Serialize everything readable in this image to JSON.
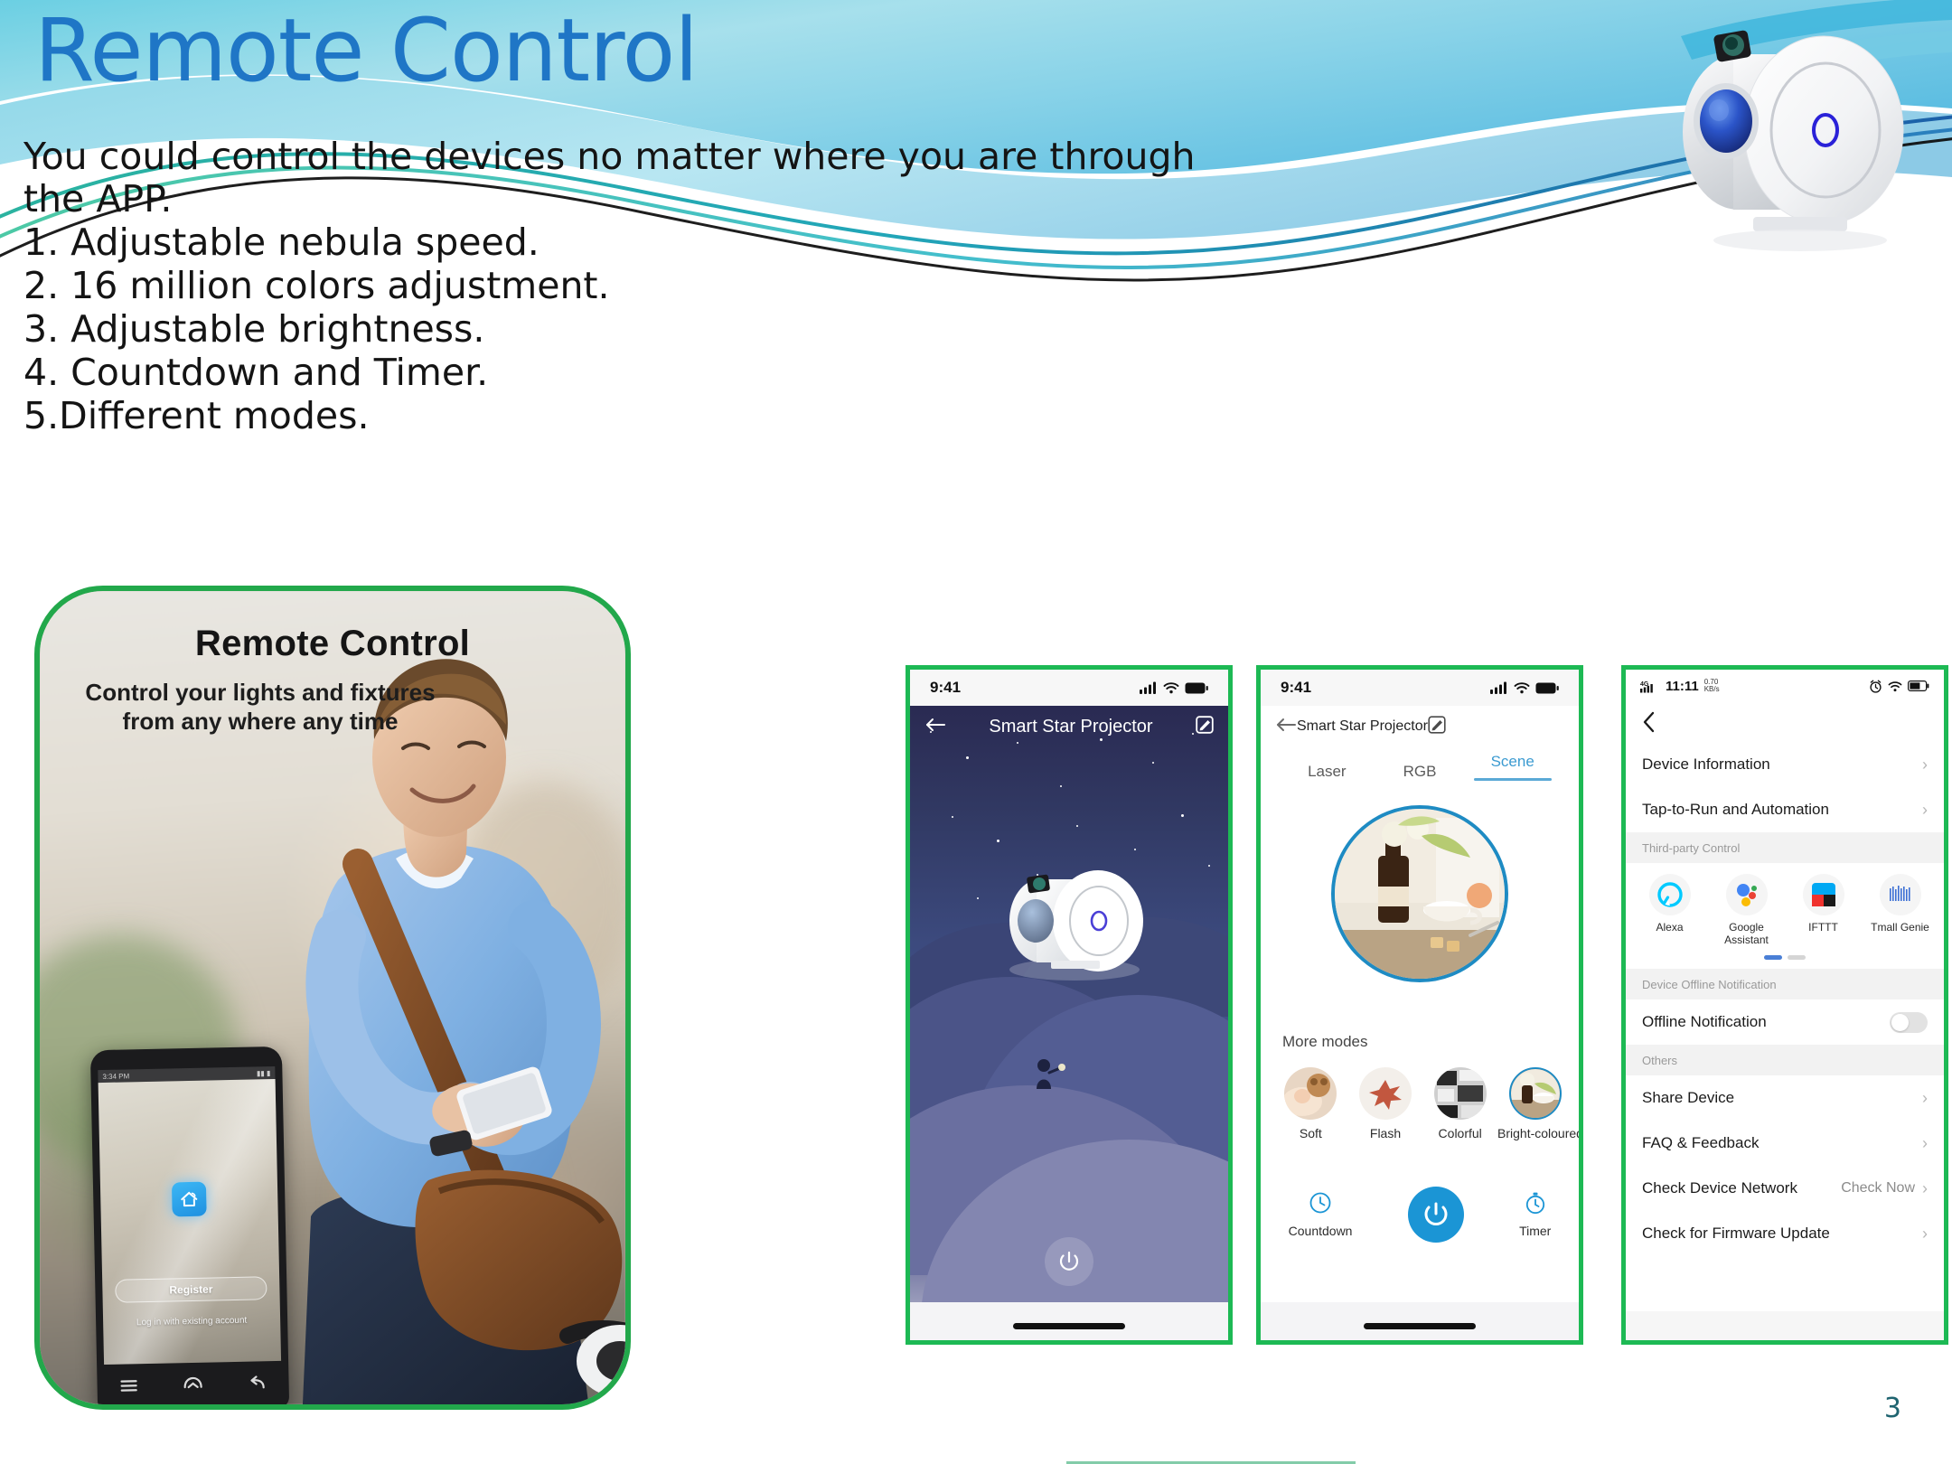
{
  "slide": {
    "title": "Remote Control",
    "page_number": "3",
    "body_lines": [
      "You could control the devices no matter where you are through",
      "the APP.",
      "1. Adjustable nebula speed.",
      "2. 16 million colors adjustment.",
      "3. Adjustable brightness.",
      "4. Countdown and Timer.",
      "5.Different modes."
    ],
    "colors": {
      "title_blue": "#1F76C6",
      "accent_teal": "#29B5C8",
      "card_green": "#22A84B",
      "app_blue": "#1B95D5",
      "page_num": "#1F6470"
    }
  },
  "photo_card": {
    "headline": "Remote Control",
    "subhead": "Control your lights and fixtures from any where any time",
    "inner_phone": {
      "status_time": "3:34 PM",
      "app_icon": "smart-home-icon",
      "register_label": "Register",
      "login_label": "Log in with existing account",
      "nav_icons": [
        "menu-icon",
        "home-icon",
        "back-icon"
      ]
    }
  },
  "phone1": {
    "status": {
      "time": "9:41",
      "icons": [
        "cellular-icon",
        "wifi-icon",
        "battery-icon"
      ]
    },
    "navbar": {
      "back": "back-arrow-icon",
      "title": "Smart Star Projector",
      "edit": "edit-icon"
    },
    "power_button": "power-icon"
  },
  "phone2": {
    "status": {
      "time": "9:41",
      "icons": [
        "cellular-icon",
        "wifi-icon",
        "battery-icon"
      ]
    },
    "navbar": {
      "back": "back-arrow-icon",
      "title": "Smart Star Projector",
      "edit": "edit-icon"
    },
    "tabs": [
      {
        "label": "Laser",
        "active": false
      },
      {
        "label": "RGB",
        "active": false
      },
      {
        "label": "Scene",
        "active": true
      }
    ],
    "more_modes_label": "More modes",
    "modes": [
      {
        "label": "Soft",
        "selected": false
      },
      {
        "label": "Flash",
        "selected": false
      },
      {
        "label": "Colorful",
        "selected": false
      },
      {
        "label": "Bright-coloured",
        "selected": true
      }
    ],
    "controls": {
      "countdown_label": "Countdown",
      "timer_label": "Timer",
      "power_label": "power-icon"
    }
  },
  "phone3": {
    "status": {
      "network": "4G",
      "time": "11:11",
      "speed_value": "0.70",
      "speed_unit": "KB/s",
      "icons": [
        "alarm-icon",
        "wifi-icon",
        "battery-icon"
      ]
    },
    "back": "chevron-left-icon",
    "rows_top": [
      {
        "label": "Device Information",
        "value": "",
        "chevron": true
      },
      {
        "label": "Tap-to-Run and Automation",
        "value": "",
        "chevron": true
      }
    ],
    "third_party_header": "Third-party Control",
    "third_party": [
      {
        "label": "Alexa",
        "icon": "alexa-icon"
      },
      {
        "label": "Google Assistant",
        "icon": "google-assistant-icon"
      },
      {
        "label": "IFTTT",
        "icon": "ifttt-icon"
      },
      {
        "label": "Tmall Genie",
        "icon": "tmall-genie-icon"
      }
    ],
    "offline_header": "Device Offline Notification",
    "offline_row": {
      "label": "Offline Notification",
      "toggle_on": false
    },
    "others_header": "Others",
    "rows_others": [
      {
        "label": "Share Device",
        "value": "",
        "chevron": true
      },
      {
        "label": "FAQ & Feedback",
        "value": "",
        "chevron": true
      },
      {
        "label": "Check Device Network",
        "value": "Check Now",
        "chevron": true
      },
      {
        "label": "Check for Firmware Update",
        "value": "",
        "chevron": true
      }
    ]
  }
}
